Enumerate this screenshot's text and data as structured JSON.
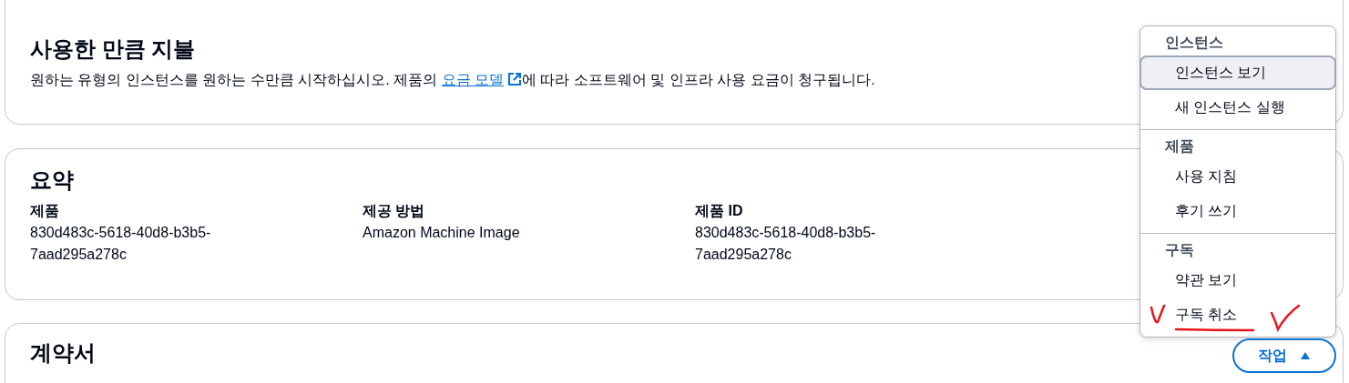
{
  "intro": {
    "title": "사용한 만큼 지불",
    "text_before": "원하는 유형의 인스턴스를 원하는 수만큼 시작하십시오. 제품의 ",
    "link": "요금 모델",
    "text_after": "에 따라 소프트웨어 및 인프라 사용 요금이 청구됩니다."
  },
  "summary": {
    "title": "요약",
    "fields": [
      {
        "label": "제품",
        "value": "830d483c-5618-40d8-b3b5-7aad295a278c"
      },
      {
        "label": "제공 방법",
        "value": "Amazon Machine Image"
      },
      {
        "label": "제품 ID",
        "value": "830d483c-5618-40d8-b3b5-7aad295a278c"
      }
    ]
  },
  "contract": {
    "title": "계약서"
  },
  "actions_menu": {
    "groups": [
      {
        "heading": "인스턴스",
        "items": [
          {
            "label": "인스턴스 보기",
            "selected": true
          },
          {
            "label": "새 인스턴스 실행",
            "selected": false
          }
        ]
      },
      {
        "heading": "제품",
        "items": [
          {
            "label": "사용 지침",
            "selected": false
          },
          {
            "label": "후기 쓰기",
            "selected": false
          }
        ]
      },
      {
        "heading": "구독",
        "items": [
          {
            "label": "약관 보기",
            "selected": false
          },
          {
            "label": "구독 취소",
            "selected": false
          }
        ]
      }
    ]
  },
  "actions_button": {
    "label": "작업",
    "expanded": true
  }
}
